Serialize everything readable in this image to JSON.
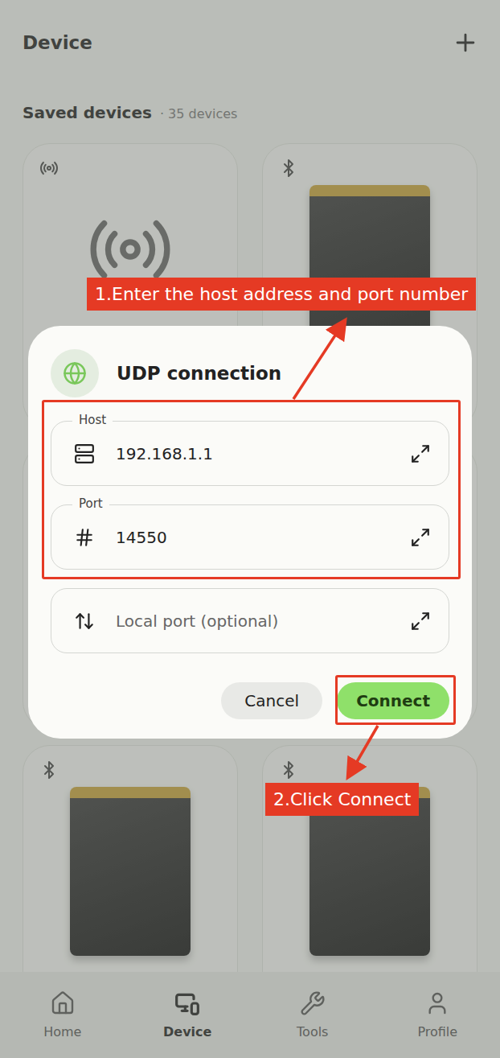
{
  "header": {
    "title": "Device"
  },
  "saved": {
    "title": "Saved devices",
    "count": "· 35 devices"
  },
  "devices": [
    {
      "kind": "radio"
    },
    {
      "kind": "bluetooth"
    },
    {
      "kind": "bluetooth"
    },
    {
      "kind": "bluetooth"
    },
    {
      "kind": "bluetooth"
    },
    {
      "kind": "bluetooth"
    }
  ],
  "dialog": {
    "title": "UDP connection",
    "fields": [
      {
        "kind": "host",
        "label": "Host",
        "value": "192.168.1.1",
        "placeholder": ""
      },
      {
        "kind": "port",
        "label": "Port",
        "value": "14550",
        "placeholder": ""
      },
      {
        "kind": "local",
        "label": "",
        "value": "",
        "placeholder": "Local port (optional)"
      }
    ],
    "buttons": [
      {
        "label": "Cancel",
        "primary": false
      },
      {
        "label": "Connect",
        "primary": true
      }
    ]
  },
  "annotations": [
    {
      "text": "1.Enter the host address and port number"
    },
    {
      "text": "2.Click Connect"
    }
  ],
  "nav": [
    {
      "label": "Home",
      "selected": false
    },
    {
      "label": "Device",
      "selected": true
    },
    {
      "label": "Tools",
      "selected": false
    },
    {
      "label": "Profile",
      "selected": false
    }
  ]
}
